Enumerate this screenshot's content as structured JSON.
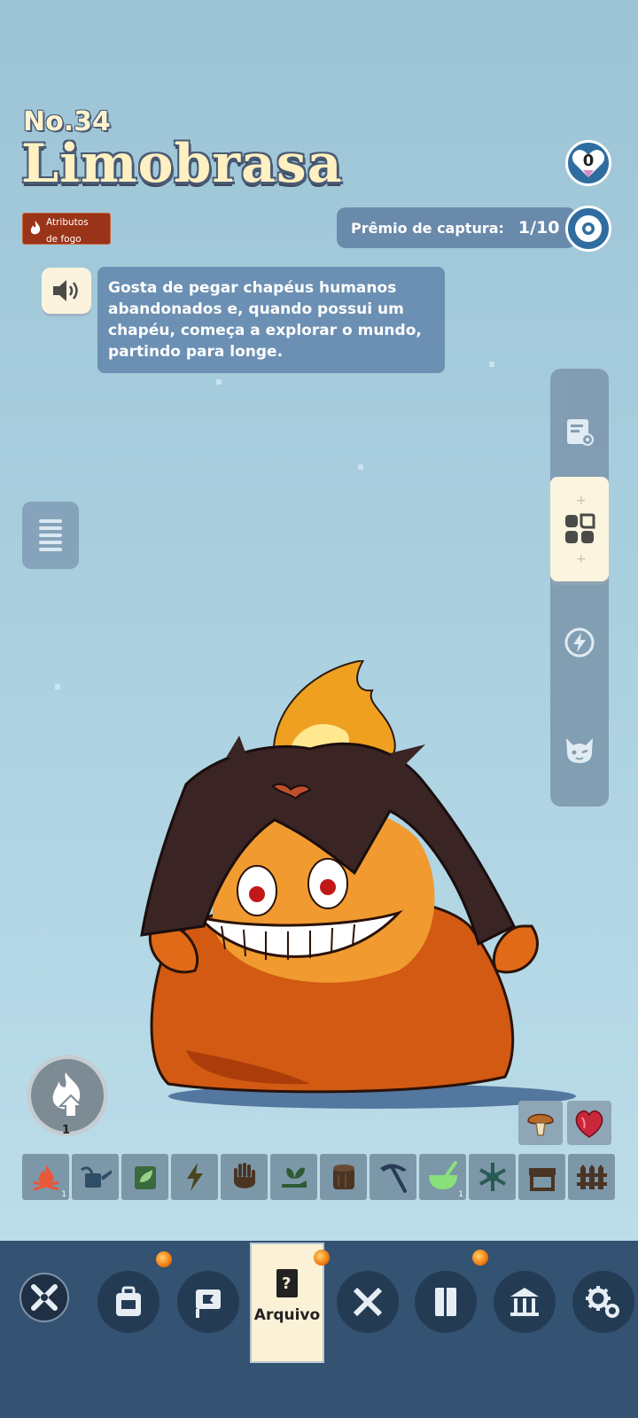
{
  "header": {
    "number": "No.34",
    "name": "Limobrasa",
    "attribute_label_line1": "Atributos",
    "attribute_label_line2": "de fogo",
    "heart_count": "0"
  },
  "capture": {
    "label": "Prêmio de captura:",
    "value": "1/10"
  },
  "description": {
    "text": "Gosta de pegar chapéus humanos abandonados e, quando possui um chapéu, começa a explorar o mundo, partindo para longe."
  },
  "right_panel": {
    "items": [
      "stats-icon",
      "partner-skill-icon",
      "active-skill-icon",
      "pal-face-icon"
    ]
  },
  "level": {
    "value": "1"
  },
  "food_items": [
    "mushroom-icon",
    "heart-meat-icon"
  ],
  "work_skills": [
    {
      "name": "kindling",
      "level": "1",
      "color": "#e8583a"
    },
    {
      "name": "watering",
      "level": "",
      "color": "#2e4e66"
    },
    {
      "name": "planting",
      "level": "",
      "color": "#3a6a3e"
    },
    {
      "name": "generating-electricity",
      "level": "",
      "color": "#4a4420"
    },
    {
      "name": "handiwork",
      "level": "",
      "color": "#4a3424"
    },
    {
      "name": "gathering",
      "level": "",
      "color": "#2c5a34"
    },
    {
      "name": "lumbering",
      "level": "",
      "color": "#4a3424"
    },
    {
      "name": "mining",
      "level": "",
      "color": "#273a56"
    },
    {
      "name": "medicine-production",
      "level": "1",
      "color": "#8ae07a"
    },
    {
      "name": "cooling",
      "level": "",
      "color": "#2a5a56"
    },
    {
      "name": "transporting",
      "level": "",
      "color": "#4a3424"
    },
    {
      "name": "farming",
      "level": "",
      "color": "#4a3424"
    }
  ],
  "bottom_nav": {
    "active_label": "Arquivo",
    "items": [
      "close",
      "backpack",
      "base",
      "archive",
      "tech",
      "journal",
      "museum",
      "settings"
    ]
  },
  "colors": {
    "accent_dark": "#345272",
    "fire_badge": "#9a3418",
    "cream": "#fbf1d6"
  }
}
